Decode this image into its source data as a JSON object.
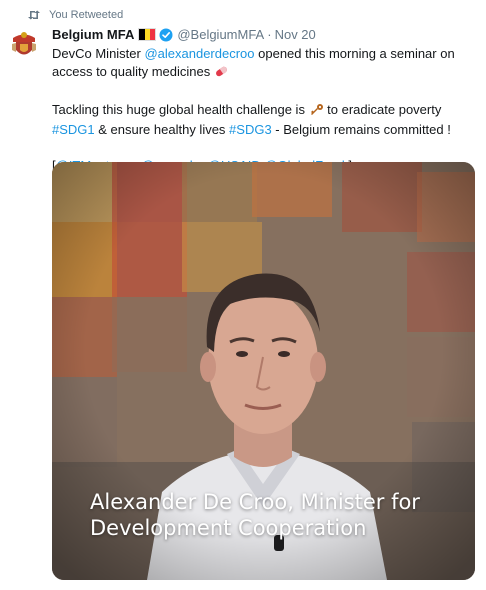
{
  "retweet": {
    "label": "You Retweeted"
  },
  "tweet": {
    "author_name": "Belgium MFA",
    "handle": "@BelgiumMFA",
    "separator": "·",
    "date": "Nov 20",
    "flag_colors": [
      "#000000",
      "#FDDA24",
      "#EF3340"
    ],
    "verified_icon": "verified-badge-icon",
    "p1": {
      "before": "DevCo Minister ",
      "mention": "@alexanderdecroo",
      "after": " opened this morning a seminar on access to quality medicines",
      "emoji": "pill-emoji"
    },
    "p2": {
      "before": "Tackling this huge global health challenge is ",
      "emoji": "key-emoji",
      "middle": " to eradicate poverty ",
      "tag1": "#SDG1",
      "middle2": " & ensure healthy lives ",
      "tag2": "#SDG3",
      "after": " - Belgium remains committed !"
    },
    "p3": {
      "open": "[",
      "m1": "@ITMantwerp",
      "m2": "@eu_echo",
      "m3": "@USAID",
      "m4": "@GlobalFund",
      "close": " ]"
    }
  },
  "media": {
    "caption_line1": "Alexander De Croo, Minister for",
    "caption_line2": "Development Cooperation"
  },
  "colors": {
    "link": "#1b95e0",
    "muted": "#657786",
    "verified": "#1da1f2"
  }
}
